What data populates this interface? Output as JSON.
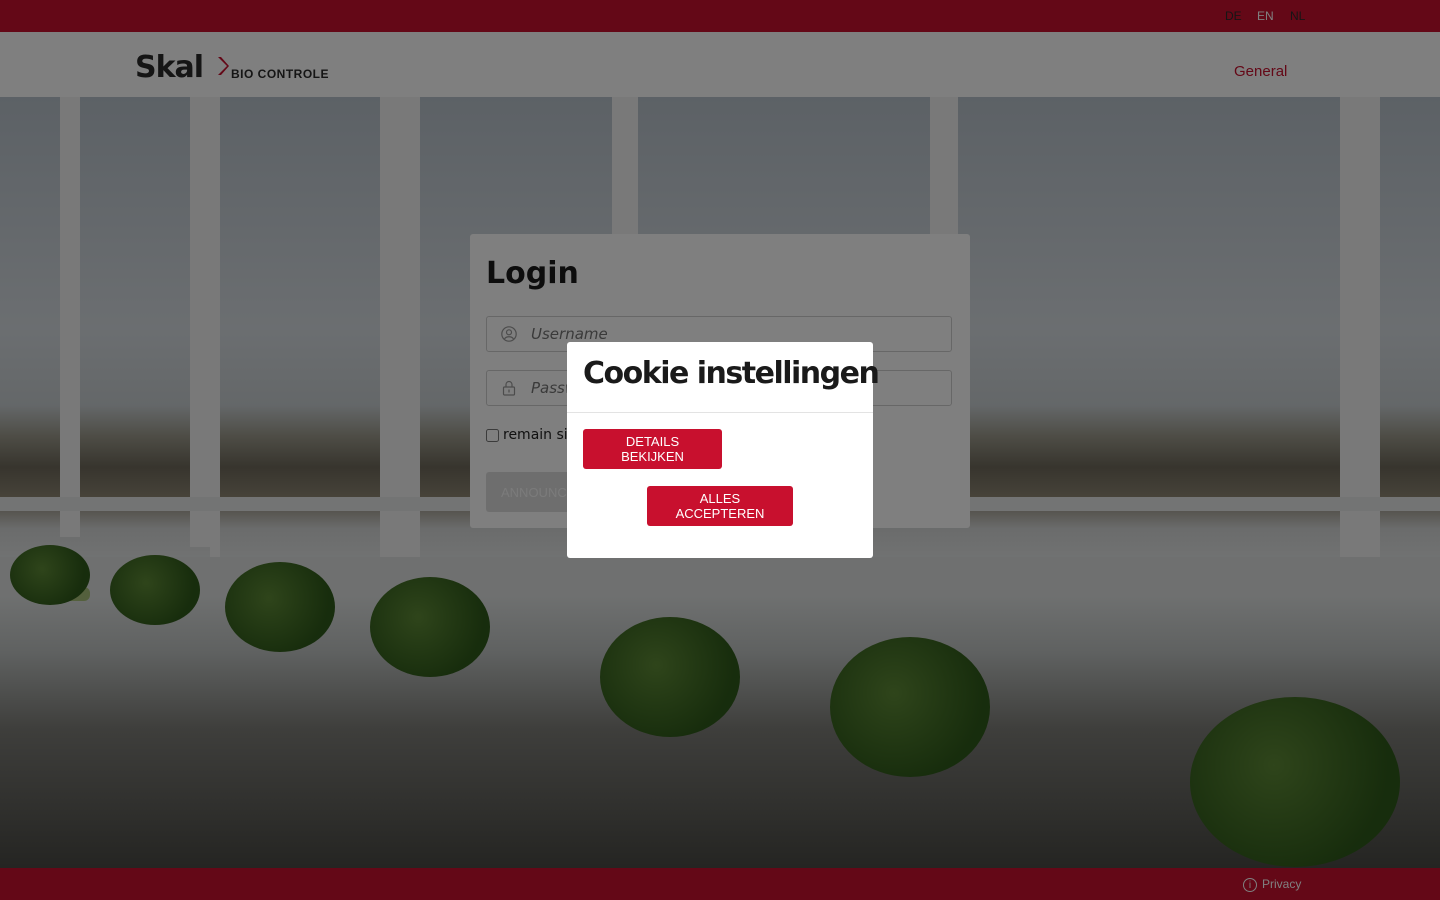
{
  "topbar": {
    "languages": [
      {
        "code": "DE",
        "active": false
      },
      {
        "code": "EN",
        "active": true
      },
      {
        "code": "NL",
        "active": false
      }
    ]
  },
  "header": {
    "logo_text": "Skal",
    "logo_tagline": "BIO CONTROLE",
    "nav_general": "General"
  },
  "login": {
    "title": "Login",
    "username_placeholder": "Username",
    "password_placeholder": "Password",
    "remain_label": "remain signed in",
    "announce_label": "ANNOUNCE"
  },
  "cookie_modal": {
    "title": "Cookie instellingen",
    "details_label": "DETAILS BEKIJKEN",
    "accept_label": "ALLES ACCEPTEREN"
  },
  "footer": {
    "privacy_label": "Privacy"
  },
  "colors": {
    "brand_red": "#c8102e",
    "overlay": "rgba(0,0,0,0.5)"
  }
}
